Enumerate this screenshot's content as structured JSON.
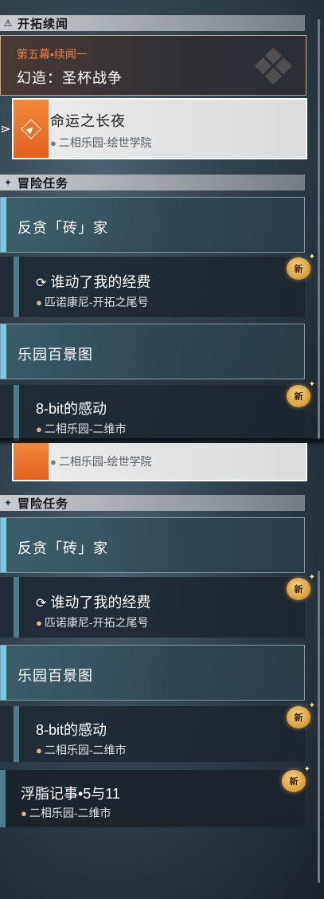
{
  "top": {
    "section1": {
      "icon": "triangle-icon",
      "title": "开拓续闻"
    },
    "act": {
      "subtitle": "第五幕•续闻一",
      "title": "幻造：圣杯战争"
    },
    "selected": {
      "title": "命运之长夜",
      "location": "二相乐园-绘世学院"
    },
    "section2": {
      "icon": "diamond-icon",
      "title": "冒险任务"
    },
    "group1": {
      "label": "反贪「砖」家"
    },
    "quest1": {
      "title": "谁动了我的经费",
      "location": "匹诺康尼-开拓之尾号",
      "badge": "新"
    },
    "group2": {
      "label": "乐园百景图"
    },
    "quest2": {
      "title": "8-bit的感动",
      "location": "二相乐园-二维市",
      "badge": "新"
    }
  },
  "bottom": {
    "selected_partial": {
      "location": "二相乐园-绘世学院"
    },
    "section2": {
      "icon": "diamond-icon",
      "title": "冒险任务"
    },
    "group1": {
      "label": "反贪「砖」家"
    },
    "quest1": {
      "title": "谁动了我的经费",
      "location": "匹诺康尼-开拓之尾号",
      "badge": "新"
    },
    "group2": {
      "label": "乐园百景图"
    },
    "quest2": {
      "title": "8-bit的感动",
      "location": "二相乐园-二维市",
      "badge": "新"
    },
    "quest3": {
      "title": "浮脂记事•5与11",
      "location": "二相乐园-二维市",
      "badge": "新"
    }
  },
  "colors": {
    "accent_orange": "#e8692a",
    "accent_cyan": "#6fd0ea",
    "badge_gold": "#e0a540"
  }
}
